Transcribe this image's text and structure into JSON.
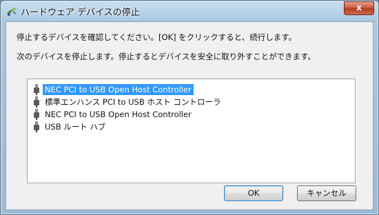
{
  "window": {
    "title": "ハードウェア デバイスの停止",
    "close_glyph": "x"
  },
  "message": {
    "line1": "停止するデバイスを確認してください。[OK] をクリックすると、続行します。",
    "line2": "次のデバイスを停止します。停止するとデバイスを安全に取り外すことができます。"
  },
  "devices": [
    {
      "label": "NEC PCI to USB Open Host Controller",
      "selected": true
    },
    {
      "label": "標準エンハンス PCI to USB ホスト コントローラ",
      "selected": false
    },
    {
      "label": "NEC PCI to USB Open Host Controller",
      "selected": false
    },
    {
      "label": "USB ルート ハブ",
      "selected": false
    }
  ],
  "buttons": {
    "ok": "OK",
    "cancel": "キャンセル"
  },
  "colors": {
    "selection": "#3399ff",
    "close_button": "#c9513a"
  },
  "icons": {
    "title": "safely-remove-hardware-icon",
    "device": "usb-plug-icon"
  }
}
